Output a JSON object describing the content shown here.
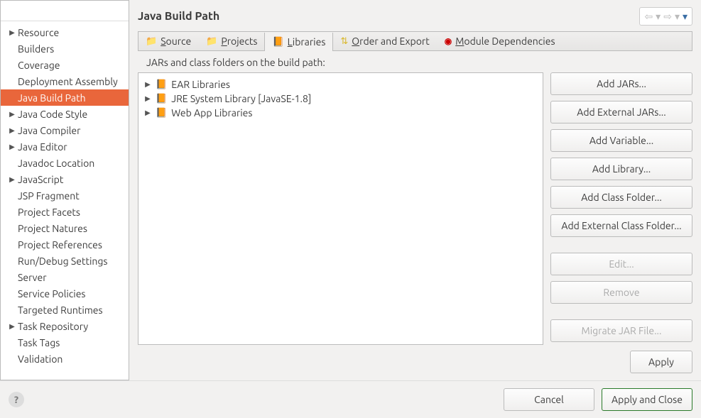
{
  "search": {
    "placeholder": ""
  },
  "sidebar": {
    "items": [
      {
        "label": "Resource",
        "expandable": true
      },
      {
        "label": "Builders",
        "expandable": false
      },
      {
        "label": "Coverage",
        "expandable": false
      },
      {
        "label": "Deployment Assembly",
        "expandable": false
      },
      {
        "label": "Java Build Path",
        "expandable": false,
        "selected": true
      },
      {
        "label": "Java Code Style",
        "expandable": true
      },
      {
        "label": "Java Compiler",
        "expandable": true
      },
      {
        "label": "Java Editor",
        "expandable": true
      },
      {
        "label": "Javadoc Location",
        "expandable": false
      },
      {
        "label": "JavaScript",
        "expandable": true
      },
      {
        "label": "JSP Fragment",
        "expandable": false
      },
      {
        "label": "Project Facets",
        "expandable": false
      },
      {
        "label": "Project Natures",
        "expandable": false
      },
      {
        "label": "Project References",
        "expandable": false
      },
      {
        "label": "Run/Debug Settings",
        "expandable": false
      },
      {
        "label": "Server",
        "expandable": false
      },
      {
        "label": "Service Policies",
        "expandable": false
      },
      {
        "label": "Targeted Runtimes",
        "expandable": false
      },
      {
        "label": "Task Repository",
        "expandable": true
      },
      {
        "label": "Task Tags",
        "expandable": false
      },
      {
        "label": "Validation",
        "expandable": false
      }
    ]
  },
  "page": {
    "title": "Java Build Path",
    "description": "JARs and class folders on the build path:"
  },
  "tabs": [
    {
      "icon": "folder",
      "pre": "",
      "mnemonic": "S",
      "post": "ource"
    },
    {
      "icon": "folder",
      "pre": "",
      "mnemonic": "P",
      "post": "rojects"
    },
    {
      "icon": "book",
      "pre": "",
      "mnemonic": "L",
      "post": "ibraries",
      "active": true
    },
    {
      "icon": "order",
      "pre": "",
      "mnemonic": "O",
      "post": "rder and Export"
    },
    {
      "icon": "red",
      "pre": "",
      "mnemonic": "M",
      "post": "odule Dependencies"
    }
  ],
  "libraries": [
    {
      "label": "EAR Libraries"
    },
    {
      "label": "JRE System Library [JavaSE-1.8]"
    },
    {
      "label": "Web App Libraries"
    }
  ],
  "buttons": {
    "addJars": "Add JARs...",
    "addExternalJars": "Add External JARs...",
    "addVariable": "Add Variable...",
    "addLibrary": "Add Library...",
    "addClassFolder": "Add Class Folder...",
    "addExternalClassFolder": "Add External Class Folder...",
    "edit": "Edit...",
    "remove": "Remove",
    "migrate": "Migrate JAR File...",
    "apply": "Apply",
    "cancel": "Cancel",
    "applyClose": "Apply and Close"
  }
}
